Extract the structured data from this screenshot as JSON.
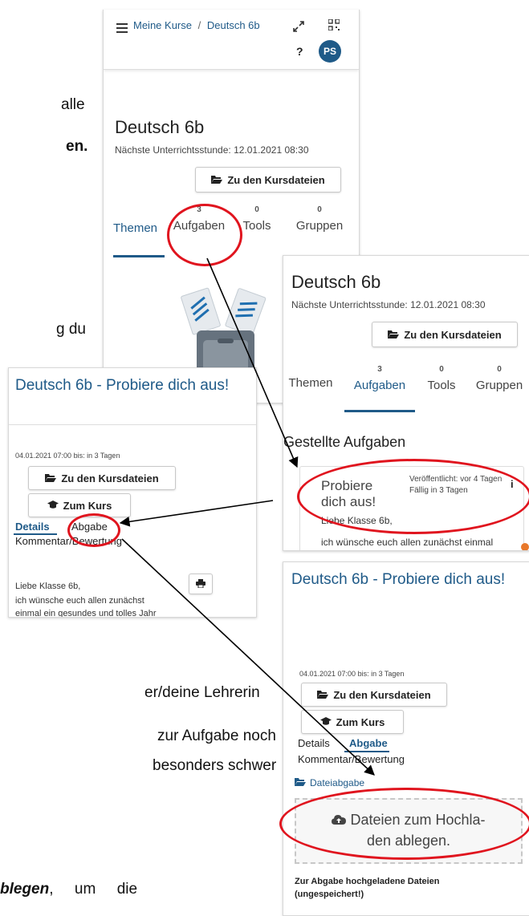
{
  "doc_fragments": {
    "l1": "alle",
    "l2": "en.",
    "l3": "g du",
    "l4": "er/deine  Lehrerin",
    "l5": "zur Aufgabe noch",
    "l6": "besonders schwer",
    "l7_bold": "blegen",
    "l7_rest": ",     um     die"
  },
  "card1": {
    "breadcrumb_course": "Meine Kurse",
    "breadcrumb_sep": "/",
    "breadcrumb_current": "Deutsch 6b",
    "help": "?",
    "avatar": "PS",
    "title": "Deutsch 6b",
    "next_lesson": "Nächste Unterrichtsstunde: 12.01.2021 08:30",
    "files_button": "Zu den Kursdateien",
    "tabs": [
      {
        "label": "Themen",
        "count": ""
      },
      {
        "label": "Aufgaben",
        "count": "3"
      },
      {
        "label": "Tools",
        "count": "0"
      },
      {
        "label": "Gruppen",
        "count": "0"
      }
    ]
  },
  "card2": {
    "title": "Deutsch 6b",
    "next_lesson": "Nächste Unterrichtsstunde: 12.01.2021 08:30",
    "files_button": "Zu den Kursdateien",
    "tabs": [
      {
        "label": "Themen",
        "count": ""
      },
      {
        "label": "Aufgaben",
        "count": "3"
      },
      {
        "label": "Tools",
        "count": "0"
      },
      {
        "label": "Gruppen",
        "count": "0"
      }
    ],
    "section_title": "Gestellte Aufgaben",
    "task_title": "Probiere dich aus!",
    "published": "Veröffentlicht: vor 4 Tagen",
    "due": "Fällig in 3 Tagen",
    "info": "i",
    "greeting": "Liebe Klasse 6b,",
    "body": "ich wünsche euch allen zunächst einmal ein gesundes und tolles Jahr"
  },
  "card3": {
    "title": "Deutsch 6b - Probiere dich aus!",
    "date": "04.01.2021 07:00 bis: in 3 Tagen",
    "files_button": "Zu den Kursdateien",
    "course_button": "Zum Kurs",
    "tab_details": "Details",
    "tab_submission": "Abgabe",
    "tab_comment": "Kommentar/Bewertung",
    "greeting": "Liebe Klasse 6b,",
    "body1": "ich wünsche euch allen zunächst",
    "body2": "einmal ein gesundes und tolles Jahr"
  },
  "card4": {
    "title": "Deutsch 6b - Probiere dich aus!",
    "date": "04.01.2021 07:00 bis: in 3 Tagen",
    "files_button": "Zu den Kursdateien",
    "course_button": "Zum Kurs",
    "tab_details": "Details",
    "tab_submission": "Abgabe",
    "tab_comment": "Kommentar/Bewertung",
    "upload_link": "Dateiabgabe",
    "dropzone": "Dateien zum Hochla-den ablegen.",
    "dropzone_l1": "Dateien zum Hochla-",
    "dropzone_l2": "den ablegen.",
    "uploaded_heading": "Zur Abgabe hochgeladene Dateien (ungespeichert!)",
    "uploaded_l1": "Zur Abgabe hochgeladene Dateien",
    "uploaded_l2": "(ungespeichert!)"
  },
  "colors": {
    "accent": "#1f5a88",
    "highlight": "#e0141e",
    "avatar": "#1f5a88"
  }
}
